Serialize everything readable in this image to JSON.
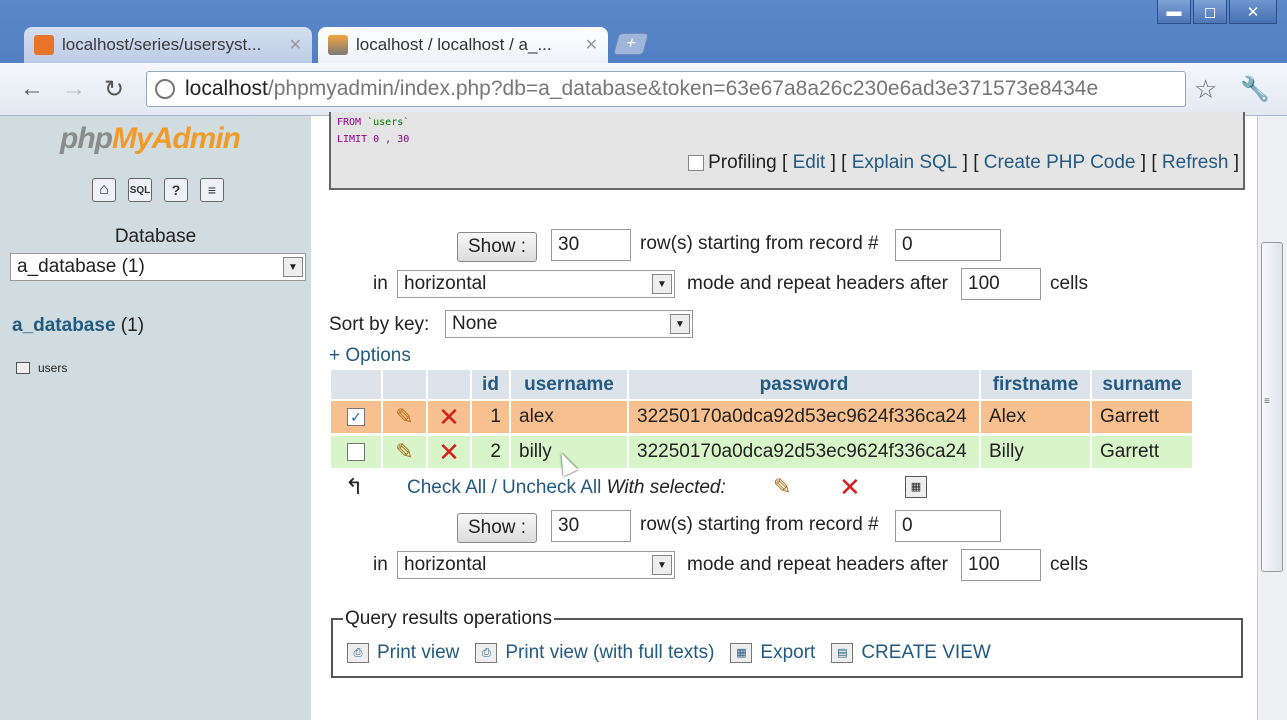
{
  "window": {
    "minimize": "▬",
    "maximize": "◻",
    "close": "✕"
  },
  "tabs": [
    {
      "title": "localhost/series/usersyst...",
      "close": "✕"
    },
    {
      "title": "localhost / localhost / a_...",
      "close": "✕"
    }
  ],
  "newtab": "+",
  "toolbar": {
    "back": "←",
    "forward": "→",
    "reload": "↻",
    "url_host": "localhost",
    "url_rest": "/phpmyadmin/index.php?db=a_database&token=63e67a8a26c230e6ad3e371573e8434e",
    "star": "☆",
    "wrench": "🔧"
  },
  "leftnav": {
    "logo_php": "php",
    "logo_my": "MyAdmin",
    "icons": [
      {
        "name": "home-icon",
        "glyph": "⌂"
      },
      {
        "name": "sql-icon",
        "glyph": "SQL"
      },
      {
        "name": "help-icon",
        "glyph": "?"
      },
      {
        "name": "docs-icon",
        "glyph": "≡"
      }
    ],
    "db_label": "Database",
    "db_select": "a_database (1)",
    "db_link": "a_database",
    "db_count": "(1)",
    "tables": [
      "users"
    ]
  },
  "sql": {
    "line1_kw": "FROM",
    "line1_tbl": "`users`",
    "line2_kw": "LIMIT",
    "line2_vals": "0 , 30",
    "profiling": "Profiling",
    "edit": "Edit",
    "explain": "Explain SQL",
    "php": "Create PHP Code",
    "refresh": "Refresh"
  },
  "nav_controls": {
    "show": "Show :",
    "rows": "30",
    "rows_label": "row(s) starting from record #",
    "start": "0",
    "in_label": "in",
    "mode": "horizontal",
    "mode_label": "mode and repeat headers after",
    "repeat": "100",
    "cells": "cells"
  },
  "sort": {
    "label": "Sort by key:",
    "value": "None"
  },
  "options": "+ Options",
  "table": {
    "headers": [
      "id",
      "username",
      "password",
      "firstname",
      "surname"
    ],
    "rows": [
      {
        "checked": "✓",
        "id": "1",
        "username": "alex",
        "password": "32250170a0dca92d53ec9624f336ca24",
        "firstname": "Alex",
        "surname": "Garrett"
      },
      {
        "checked": "",
        "id": "2",
        "username": "billy",
        "password": "32250170a0dca92d53ec9624f336ca24",
        "firstname": "Billy",
        "surname": "Garrett"
      }
    ]
  },
  "bulk": {
    "check_all": "Check All",
    "sep": "/",
    "uncheck_all": "Uncheck All",
    "with_selected": "With selected:"
  },
  "ops": {
    "legend": "Query results operations",
    "print": "Print view",
    "print_full": "Print view (with full texts)",
    "export": "Export",
    "create_view": "CREATE VIEW"
  }
}
